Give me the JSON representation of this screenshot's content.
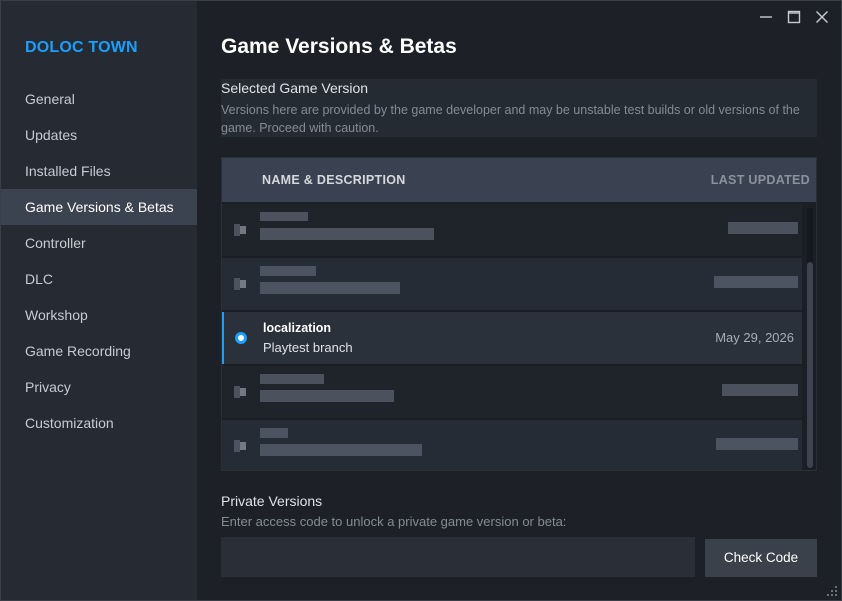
{
  "app": {
    "title": "DOLOC TOWN"
  },
  "sidebar": {
    "items": [
      {
        "label": "General",
        "active": false
      },
      {
        "label": "Updates",
        "active": false
      },
      {
        "label": "Installed Files",
        "active": false
      },
      {
        "label": "Game Versions & Betas",
        "active": true
      },
      {
        "label": "Controller",
        "active": false
      },
      {
        "label": "DLC",
        "active": false
      },
      {
        "label": "Workshop",
        "active": false
      },
      {
        "label": "Game Recording",
        "active": false
      },
      {
        "label": "Privacy",
        "active": false
      },
      {
        "label": "Customization",
        "active": false
      }
    ]
  },
  "window_controls": {
    "minimize_icon": "minimize-icon",
    "maximize_icon": "maximize-icon",
    "close_icon": "close-icon"
  },
  "main": {
    "title": "Game Versions & Betas",
    "selected_section": {
      "heading": "Selected Game Version",
      "description": "Versions here are provided by the game developer and may be unstable test builds or old versions of the game. Proceed with caution."
    },
    "table": {
      "col_name": "NAME & DESCRIPTION",
      "col_updated": "LAST UPDATED",
      "selected_row": {
        "name": "localization",
        "description": "Playtest branch",
        "date": "May 29, 2026"
      }
    },
    "private": {
      "heading": "Private Versions",
      "description": "Enter access code to unlock a private game version or beta:",
      "input_value": "",
      "input_placeholder": "",
      "button_label": "Check Code"
    }
  },
  "colors": {
    "accent": "#1a9fff",
    "sidebar_bg": "#262b33",
    "main_bg": "#1d2127",
    "active_item_bg": "#3b4250"
  }
}
